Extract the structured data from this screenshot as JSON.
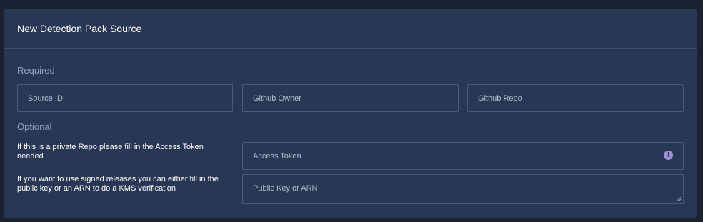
{
  "panel": {
    "title": "New Detection Pack Source"
  },
  "required": {
    "label": "Required",
    "source_id_placeholder": "Source ID",
    "github_owner_placeholder": "Github Owner",
    "github_repo_placeholder": "Github Repo"
  },
  "optional": {
    "label": "Optional",
    "access_token_help": "If this is a private Repo please fill in the Access Token needed",
    "access_token_placeholder": "Access Token",
    "public_key_help": "If you want to use signed releases you can either fill in the public key or an ARN to do a KMS verification",
    "public_key_placeholder": "Public Key or ARN"
  },
  "icons": {
    "access_token_status": "exclamation-circle-icon",
    "textarea_resize": "resize-grip-icon"
  },
  "colors": {
    "background": "#1a2232",
    "panel": "#283754",
    "section_label": "#8fa3c2",
    "field_border": "#4a5b79",
    "warning_icon": "#9d8fd6"
  }
}
